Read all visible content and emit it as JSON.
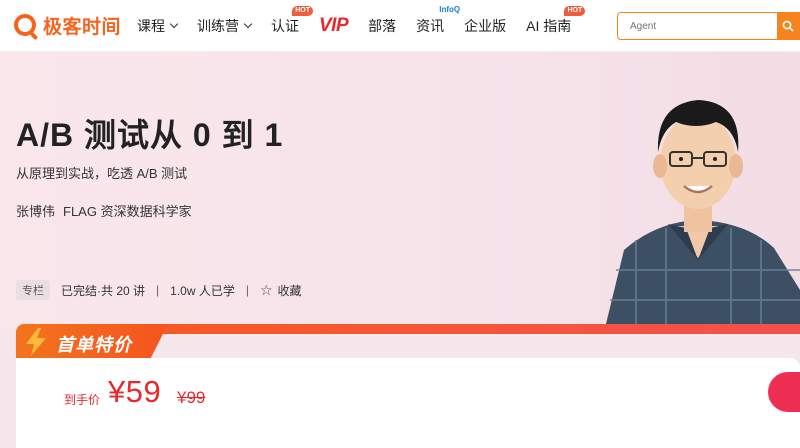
{
  "brand": {
    "name": "极客时间",
    "color": "#f5641e"
  },
  "nav": {
    "items": [
      {
        "label": "课程",
        "dropdown": true
      },
      {
        "label": "训练营",
        "dropdown": true
      },
      {
        "label": "认证",
        "badge": "HOT"
      },
      {
        "label": "VIP"
      },
      {
        "label": "部落"
      },
      {
        "label": "资讯",
        "badge": "InfoQ"
      },
      {
        "label": "企业版"
      },
      {
        "label": "AI 指南",
        "badge": "HOT"
      }
    ]
  },
  "search": {
    "placeholder": "Agent"
  },
  "course": {
    "title": "A/B 测试从 0 到 1",
    "subtitle": "从原理到实战，吃透 A/B 测试",
    "author_name": "张博伟",
    "author_title": "FLAG 资深数据科学家",
    "type_badge": "专栏",
    "status": "已完结·共 20 讲",
    "learners": "1.0w 人已学",
    "favorite_label": "收藏"
  },
  "promo": {
    "tag": "首单特价",
    "price_label": "到手价",
    "price_now": "¥59",
    "price_original": "¥99"
  },
  "colors": {
    "accent": "#f5641e",
    "price": "#e8282d",
    "buy": "#ee2e52"
  }
}
